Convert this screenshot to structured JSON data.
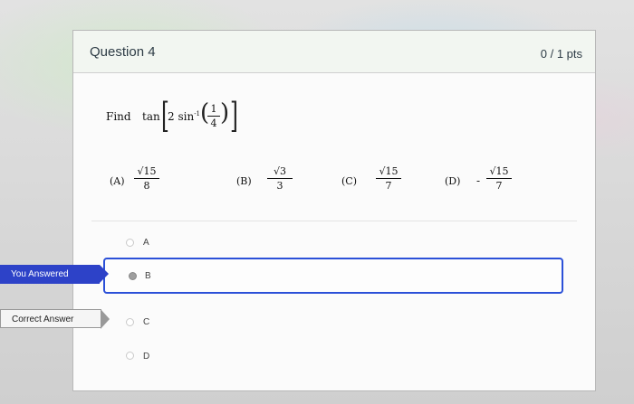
{
  "question": {
    "title": "Question 4",
    "points": "0 / 1 pts",
    "stem": {
      "find": "Find",
      "func": "tan",
      "inner": "2 sin",
      "sup": "-1",
      "num": "1",
      "den": "4"
    },
    "options": [
      {
        "label": "(A)",
        "sign": "",
        "num": "√15",
        "den": "8"
      },
      {
        "label": "(B)",
        "sign": "",
        "num": "√3",
        "den": "3"
      },
      {
        "label": "(C)",
        "sign": "",
        "num": "√15",
        "den": "7"
      },
      {
        "label": "(D)",
        "sign": "-",
        "num": "√15",
        "den": "7"
      }
    ]
  },
  "answers": [
    {
      "letter": "A",
      "selected": false
    },
    {
      "letter": "B",
      "selected": true
    },
    {
      "letter": "C",
      "selected": false
    },
    {
      "letter": "D",
      "selected": false
    }
  ],
  "flags": {
    "you_answered": "You Answered",
    "correct_answer": "Correct Answer"
  },
  "colors": {
    "accent": "#2b50d8",
    "flag": "#2d42c8"
  }
}
